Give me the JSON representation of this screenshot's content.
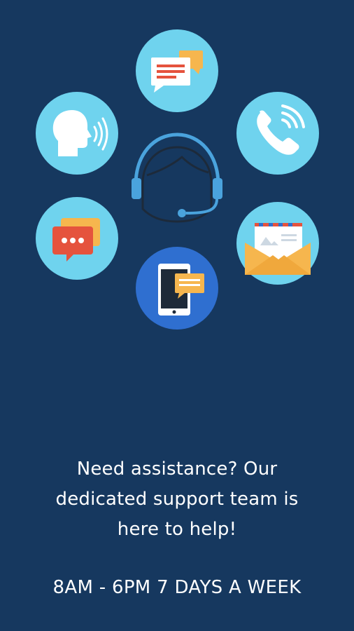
{
  "support_screen": {
    "message_lines": [
      "Need assistance? Our",
      "dedicated support team is",
      "here to help!"
    ],
    "hours": "8AM - 6PM 7 DAYS A WEEK"
  },
  "colors": {
    "background": "#16385f",
    "bubble": "#6fd3ee",
    "bubble_mobile": "#2f6fd0",
    "accent_orange": "#f6b64e",
    "accent_red": "#e5533d",
    "text": "#ffffff"
  },
  "icons": [
    "message-icon",
    "speaking-head-icon",
    "phone-icon",
    "chat-bubbles-icon",
    "email-envelope-icon",
    "mobile-chat-icon",
    "support-agent-headset-icon"
  ]
}
